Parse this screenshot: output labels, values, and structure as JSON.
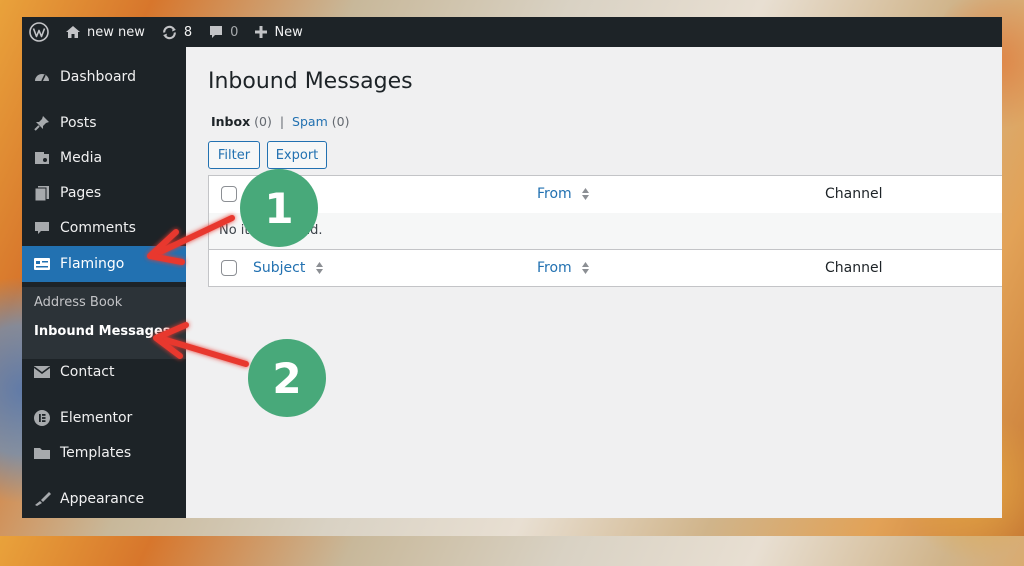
{
  "adminbar": {
    "site_name": "new new",
    "updates_count": "8",
    "comments_count": "0",
    "new_label": "New"
  },
  "sidebar": {
    "items": [
      {
        "label": "Dashboard",
        "icon": "dashboard-icon"
      },
      {
        "label": "Posts",
        "icon": "pin-icon"
      },
      {
        "label": "Media",
        "icon": "media-icon"
      },
      {
        "label": "Pages",
        "icon": "pages-icon"
      },
      {
        "label": "Comments",
        "icon": "comment-icon"
      },
      {
        "label": "Flamingo",
        "icon": "flamingo-icon"
      },
      {
        "label": "Contact",
        "icon": "mail-icon"
      },
      {
        "label": "Elementor",
        "icon": "elementor-icon"
      },
      {
        "label": "Templates",
        "icon": "folder-icon"
      },
      {
        "label": "Appearance",
        "icon": "brush-icon"
      }
    ],
    "submenu": [
      "Address Book",
      "Inbound Messages"
    ]
  },
  "main": {
    "title": "Inbound Messages",
    "views": {
      "inbox_label": "Inbox",
      "inbox_count": "(0)",
      "separator": "|",
      "spam_label": "Spam",
      "spam_count": "(0)"
    },
    "buttons": {
      "filter": "Filter",
      "export": "Export"
    },
    "table": {
      "columns": [
        "Subject",
        "From",
        "Channel"
      ],
      "empty_message": "No items found."
    }
  },
  "annotations": {
    "badge_1": "1",
    "badge_2": "2",
    "badge_color": "#48a97a",
    "arrow_color": "#e8372f"
  },
  "colors": {
    "admin_dark": "#1d2327",
    "accent_blue": "#2271b1",
    "content_bg": "#f0f0f1"
  }
}
